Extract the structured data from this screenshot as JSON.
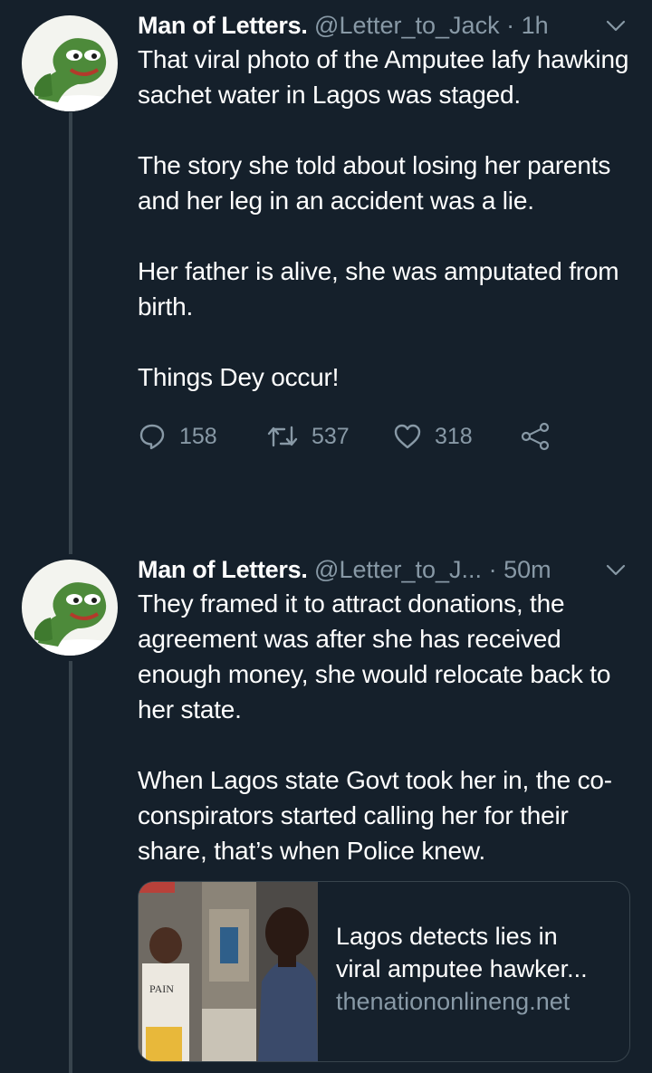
{
  "colors": {
    "background": "#15202b",
    "text_primary": "#ffffff",
    "text_secondary": "#8899a6",
    "divider": "#38444d"
  },
  "tweets": [
    {
      "name": "Man of Letters.",
      "handle": "@Letter_to_Jack",
      "time": "· 1h",
      "paragraphs": [
        "That viral photo of the Amputee lafy hawking sachet water in Lagos was staged.",
        "The story she told about losing her parents and her leg in an accident was a lie.",
        "Her father is alive, she was amputated from birth.",
        "Things Dey occur!"
      ],
      "replies": "158",
      "retweets": "537",
      "likes": "318",
      "icons": [
        "reply-icon",
        "retweet-icon",
        "like-icon",
        "share-icon",
        "chevron-down-icon"
      ]
    },
    {
      "name": "Man of Letters.",
      "handle": "@Letter_to_J...",
      "time": "· 50m",
      "paragraphs": [
        "They framed it to attract donations, the agreement was after she has received enough money, she would relocate back to her state.",
        "When Lagos state Govt took her in, the co-conspirators started calling her for their share, that’s when Police knew."
      ],
      "card": {
        "title_line1": "Lagos detects lies in",
        "title_line2": "viral amputee hawker...",
        "domain": "thenationonlineng.net",
        "image_sign_text": "PAIN"
      }
    }
  ]
}
